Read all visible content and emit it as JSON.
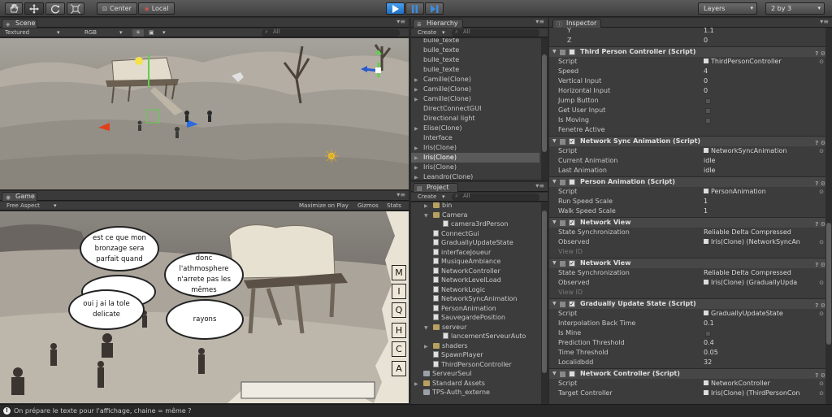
{
  "toolbar": {
    "pivot_label": "Center",
    "space_label": "Local",
    "layers_label": "Layers",
    "layout_label": "2 by 3"
  },
  "scene": {
    "tab_label": "Scene",
    "draw_mode": "Textured",
    "render_mode": "RGB",
    "search_placeholder": "All"
  },
  "game": {
    "tab_label": "Game",
    "aspect": "Free Aspect",
    "maximize_label": "Maximize on Play",
    "gizmos_label": "Gizmos",
    "stats_label": "Stats",
    "bubbles": [
      "est ce que mon bronzage sera parfait quand",
      "",
      "oui j ai la tole delicate",
      "donc l'athmosphere n'arrete pas les mêmes",
      "rayons"
    ],
    "letters": [
      "M",
      "I",
      "Q",
      "H",
      "C",
      "A"
    ]
  },
  "hierarchy": {
    "tab_label": "Hierarchy",
    "create_label": "Create",
    "search_placeholder": "All",
    "items": [
      {
        "label": "bulle_texte",
        "arrow": false,
        "selected": false
      },
      {
        "label": "bulle_texte",
        "arrow": false,
        "selected": false
      },
      {
        "label": "bulle_texte",
        "arrow": false,
        "selected": false
      },
      {
        "label": "bulle_texte",
        "arrow": false,
        "selected": false
      },
      {
        "label": "Camille(Clone)",
        "arrow": true,
        "selected": false
      },
      {
        "label": "Camille(Clone)",
        "arrow": true,
        "selected": false
      },
      {
        "label": "Camille(Clone)",
        "arrow": true,
        "selected": false
      },
      {
        "label": "DirectConnectGUI",
        "arrow": false,
        "selected": false
      },
      {
        "label": "Directional light",
        "arrow": false,
        "selected": false
      },
      {
        "label": "Elise(Clone)",
        "arrow": true,
        "selected": false
      },
      {
        "label": "Interface",
        "arrow": false,
        "selected": false
      },
      {
        "label": "Iris(Clone)",
        "arrow": true,
        "selected": false
      },
      {
        "label": "Iris(Clone)",
        "arrow": true,
        "selected": true
      },
      {
        "label": "Iris(Clone)",
        "arrow": true,
        "selected": false
      },
      {
        "label": "Leandro(Clone)",
        "arrow": true,
        "selected": false
      }
    ]
  },
  "project": {
    "tab_label": "Project",
    "create_label": "Create",
    "search_placeholder": "All",
    "items": [
      {
        "label": "bin",
        "type": "folder",
        "indent": 1,
        "arrow": "▶"
      },
      {
        "label": "Camera",
        "type": "folder",
        "indent": 1,
        "arrow": "▼"
      },
      {
        "label": "camera3rdPerson",
        "type": "script",
        "indent": 2,
        "arrow": ""
      },
      {
        "label": "ConnectGui",
        "type": "script",
        "indent": 1,
        "arrow": ""
      },
      {
        "label": "GraduallyUpdateState",
        "type": "script",
        "indent": 1,
        "arrow": ""
      },
      {
        "label": "interfaceJoueur",
        "type": "script",
        "indent": 1,
        "arrow": ""
      },
      {
        "label": "MusiqueAmbiance",
        "type": "script",
        "indent": 1,
        "arrow": ""
      },
      {
        "label": "NetworkController",
        "type": "script",
        "indent": 1,
        "arrow": ""
      },
      {
        "label": "NetworkLevelLoad",
        "type": "script",
        "indent": 1,
        "arrow": ""
      },
      {
        "label": "NetworkLogic",
        "type": "script",
        "indent": 1,
        "arrow": ""
      },
      {
        "label": "NetworkSyncAnimation",
        "type": "script",
        "indent": 1,
        "arrow": ""
      },
      {
        "label": "PersonAnimation",
        "type": "script",
        "indent": 1,
        "arrow": ""
      },
      {
        "label": "SauvegardePosition",
        "type": "script",
        "indent": 1,
        "arrow": ""
      },
      {
        "label": "serveur",
        "type": "folder",
        "indent": 1,
        "arrow": "▼"
      },
      {
        "label": "lancementServeurAuto",
        "type": "script",
        "indent": 2,
        "arrow": ""
      },
      {
        "label": "shaders",
        "type": "folder",
        "indent": 1,
        "arrow": "▶"
      },
      {
        "label": "SpawnPlayer",
        "type": "script",
        "indent": 1,
        "arrow": ""
      },
      {
        "label": "ThirdPersonController",
        "type": "script",
        "indent": 1,
        "arrow": ""
      },
      {
        "label": "ServeurSeul",
        "type": "scene",
        "indent": 0,
        "arrow": ""
      },
      {
        "label": "Standard Assets",
        "type": "folder",
        "indent": 0,
        "arrow": "▶"
      },
      {
        "label": "TPS-Auth_externe",
        "type": "scene",
        "indent": 0,
        "arrow": ""
      }
    ]
  },
  "inspector": {
    "tab_label": "Inspector",
    "transform_tail": [
      {
        "label": "Y",
        "value": "1.1"
      },
      {
        "label": "Z",
        "value": "0"
      }
    ],
    "components": [
      {
        "name": "Third Person Controller (Script)",
        "checked": false,
        "props": [
          {
            "label": "Script",
            "value": "ThirdPersonController",
            "kind": "ref"
          },
          {
            "label": "Speed",
            "value": "4",
            "kind": "text"
          },
          {
            "label": "Vertical Input",
            "value": "0",
            "kind": "text"
          },
          {
            "label": "Horizontal Input",
            "value": "0",
            "kind": "text"
          },
          {
            "label": "Jump Button",
            "value": "",
            "kind": "box"
          },
          {
            "label": "Get User Input",
            "value": "",
            "kind": "box"
          },
          {
            "label": "Is Moving",
            "value": "",
            "kind": "box"
          },
          {
            "label": "Fenetre Active",
            "value": "",
            "kind": "text"
          }
        ]
      },
      {
        "name": "Network Sync Animation (Script)",
        "checked": true,
        "props": [
          {
            "label": "Script",
            "value": "NetworkSyncAnimation",
            "kind": "ref"
          },
          {
            "label": "Current Animation",
            "value": "idle",
            "kind": "text"
          },
          {
            "label": "Last Animation",
            "value": "idle",
            "kind": "text"
          }
        ]
      },
      {
        "name": "Person Animation (Script)",
        "checked": false,
        "props": [
          {
            "label": "Script",
            "value": "PersonAnimation",
            "kind": "ref"
          },
          {
            "label": "Run Speed Scale",
            "value": "1",
            "kind": "text"
          },
          {
            "label": "Walk Speed Scale",
            "value": "1",
            "kind": "text"
          }
        ]
      },
      {
        "name": "Network View",
        "checked": true,
        "props": [
          {
            "label": "State Synchronization",
            "value": "Reliable Delta Compressed",
            "kind": "text"
          },
          {
            "label": "Observed",
            "value": "Iris(Clone) (NetworkSyncAn",
            "kind": "ref"
          },
          {
            "label": "View ID",
            "value": "",
            "kind": "muted"
          }
        ]
      },
      {
        "name": "Network View",
        "checked": true,
        "props": [
          {
            "label": "State Synchronization",
            "value": "Reliable Delta Compressed",
            "kind": "text"
          },
          {
            "label": "Observed",
            "value": "Iris(Clone) (GraduallyUpda",
            "kind": "ref"
          },
          {
            "label": "View ID",
            "value": "",
            "kind": "muted"
          }
        ]
      },
      {
        "name": "Gradually Update State (Script)",
        "checked": true,
        "props": [
          {
            "label": "Script",
            "value": "GraduallyUpdateState",
            "kind": "ref"
          },
          {
            "label": "Interpolation Back Time",
            "value": "0.1",
            "kind": "text"
          },
          {
            "label": "Is Mine",
            "value": "",
            "kind": "box"
          },
          {
            "label": "Prediction Threshold",
            "value": "0.4",
            "kind": "text"
          },
          {
            "label": "Time Threshold",
            "value": "0.05",
            "kind": "text"
          },
          {
            "label": "Localidbdd",
            "value": "32",
            "kind": "text"
          }
        ]
      },
      {
        "name": "Network Controller (Script)",
        "checked": false,
        "props": [
          {
            "label": "Script",
            "value": "NetworkController",
            "kind": "ref"
          },
          {
            "label": "Target Controller",
            "value": "Iris(Clone) (ThirdPersonCon",
            "kind": "ref"
          }
        ]
      }
    ]
  },
  "status": {
    "message": "On prépare le texte pour l'affichage, chaine = même ?"
  }
}
